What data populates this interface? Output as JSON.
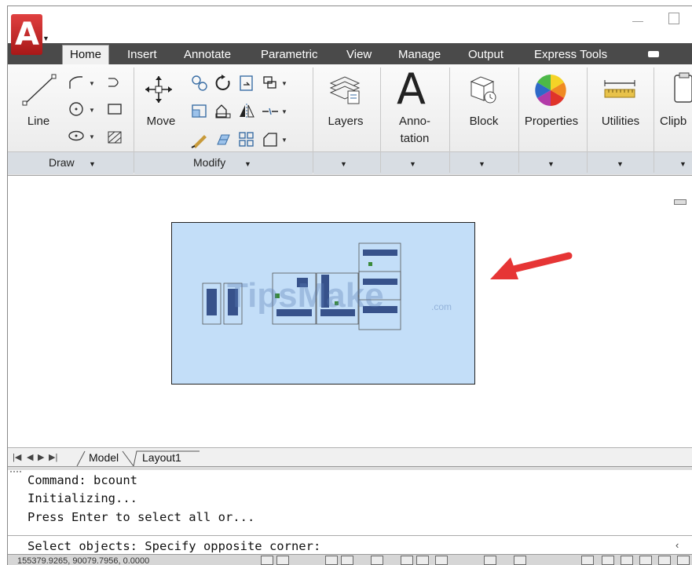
{
  "tabs": [
    "Home",
    "Insert",
    "Annotate",
    "Parametric",
    "View",
    "Manage",
    "Output",
    "Express Tools"
  ],
  "ribbon": {
    "line_label": "Line",
    "move_label": "Move",
    "layers_label": "Layers",
    "annotation_label1": "Anno-",
    "annotation_label2": "tation",
    "block_label": "Block",
    "properties_label": "Properties",
    "utilities_label": "Utilities",
    "clipboard_label": "Clipb",
    "draw_panel": "Draw",
    "modify_panel": "Modify"
  },
  "layout_tabs": {
    "model": "Model",
    "layout1": "Layout1"
  },
  "command": {
    "lines": [
      "Command: bcount",
      "Initializing...",
      "Press Enter to select all or..."
    ],
    "prompt": "Select objects: Specify opposite corner:"
  },
  "status": {
    "coords": "155379.9265, 90079.7956, 0.0000"
  },
  "watermark": {
    "brand": "TipsMake",
    "suffix": ".com"
  },
  "colors": {
    "arrow": "#e63535",
    "viewport": "#c3def8",
    "ribbon_tabs": "#4a4a4a",
    "app_button": "#c92a2a"
  },
  "icons": {
    "app": "autocad-a-icon",
    "line": "line-icon",
    "move": "move-icon",
    "layers": "layers-icon",
    "annotation": "text-a-icon",
    "block": "block-icon",
    "properties": "color-wheel-icon",
    "utilities": "measure-icon",
    "clipboard": "clipboard-icon"
  }
}
